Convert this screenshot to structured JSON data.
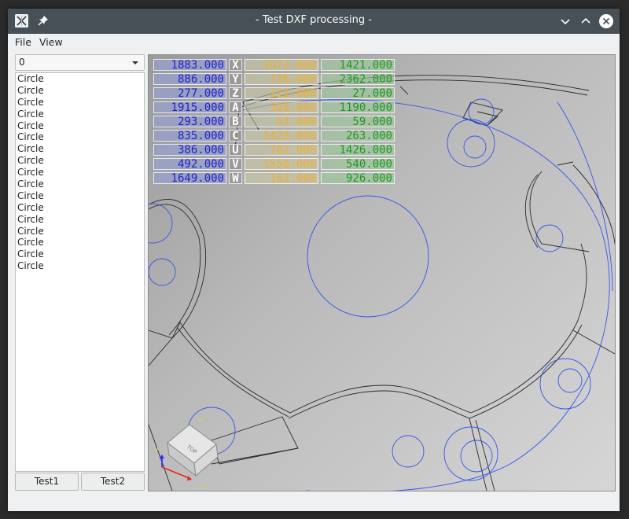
{
  "window": {
    "title": "- Test DXF processing -"
  },
  "menu": {
    "file": "File",
    "view": "View"
  },
  "sidebar": {
    "layer_combo": "0",
    "items": [
      "Circle",
      "Circle",
      "Circle",
      "Circle",
      "Circle",
      "Circle",
      "Circle",
      "Circle",
      "Circle",
      "Circle",
      "Circle",
      "Circle",
      "Circle",
      "Circle",
      "Circle",
      "Circle",
      "Circle"
    ],
    "test1": "Test1",
    "test2": "Test2"
  },
  "dro": [
    {
      "work": "1883.000",
      "axis": "X",
      "rel": "1672.000",
      "mach": "1421.000"
    },
    {
      "work": "886.000",
      "axis": "Y",
      "rel": "736.000",
      "mach": "2362.000"
    },
    {
      "work": "277.000",
      "axis": "Z",
      "rel": "211.000",
      "mach": "27.000"
    },
    {
      "work": "1915.000",
      "axis": "A",
      "rel": "368.000",
      "mach": "1190.000"
    },
    {
      "work": "293.000",
      "axis": "B",
      "rel": "67.000",
      "mach": "59.000"
    },
    {
      "work": "835.000",
      "axis": "C",
      "rel": "1429.000",
      "mach": "263.000"
    },
    {
      "work": "386.000",
      "axis": "U",
      "rel": "782.000",
      "mach": "1426.000"
    },
    {
      "work": "492.000",
      "axis": "V",
      "rel": "1558.000",
      "mach": "540.000"
    },
    {
      "work": "1649.000",
      "axis": "W",
      "rel": "162.000",
      "mach": "926.000"
    }
  ],
  "viewcube": {
    "face_label": "TOP"
  },
  "colors": {
    "titlebar": "#475057",
    "work_coord": "#2222cc",
    "rel_coord": "#f2ae2a",
    "mach_coord": "#1e9a1e",
    "circle": "#3355ee"
  },
  "icons": {
    "app": "kde-app-icon",
    "pin": "pin-icon",
    "minimize": "chevron-down-icon",
    "maximize": "chevron-up-icon",
    "close": "close-icon"
  }
}
